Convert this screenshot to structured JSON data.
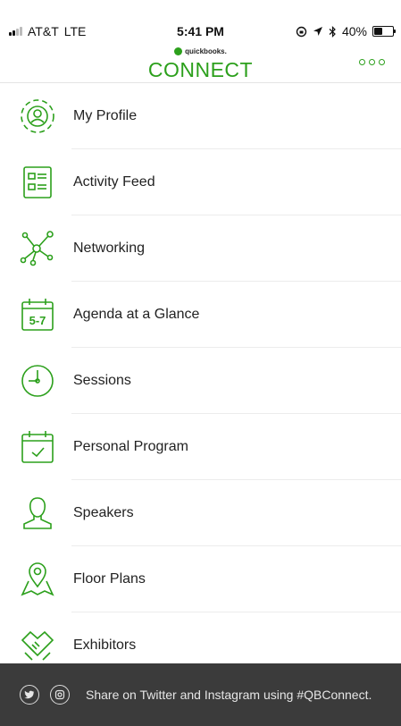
{
  "status": {
    "carrier": "AT&T",
    "network": "LTE",
    "time": "5:41 PM",
    "battery": "40%",
    "battery_level": 0.4
  },
  "header": {
    "logo_small": "quickbooks.",
    "logo_large": "CONNECT",
    "accent_color": "#2ca01c"
  },
  "menu": {
    "items": [
      {
        "label": "My Profile",
        "icon": "profile-icon"
      },
      {
        "label": "Activity Feed",
        "icon": "activity-feed-icon"
      },
      {
        "label": "Networking",
        "icon": "networking-icon"
      },
      {
        "label": "Agenda at a Glance",
        "icon": "agenda-calendar-icon",
        "icon_text": "5-7"
      },
      {
        "label": "Sessions",
        "icon": "clock-icon"
      },
      {
        "label": "Personal Program",
        "icon": "calendar-check-icon"
      },
      {
        "label": "Speakers",
        "icon": "speaker-person-icon"
      },
      {
        "label": "Floor Plans",
        "icon": "map-pin-icon"
      },
      {
        "label": "Exhibitors",
        "icon": "handshake-icon"
      }
    ]
  },
  "footer": {
    "text": "Share on Twitter and Instagram using #QBConnect.",
    "icons": [
      "twitter-icon",
      "instagram-icon"
    ]
  }
}
